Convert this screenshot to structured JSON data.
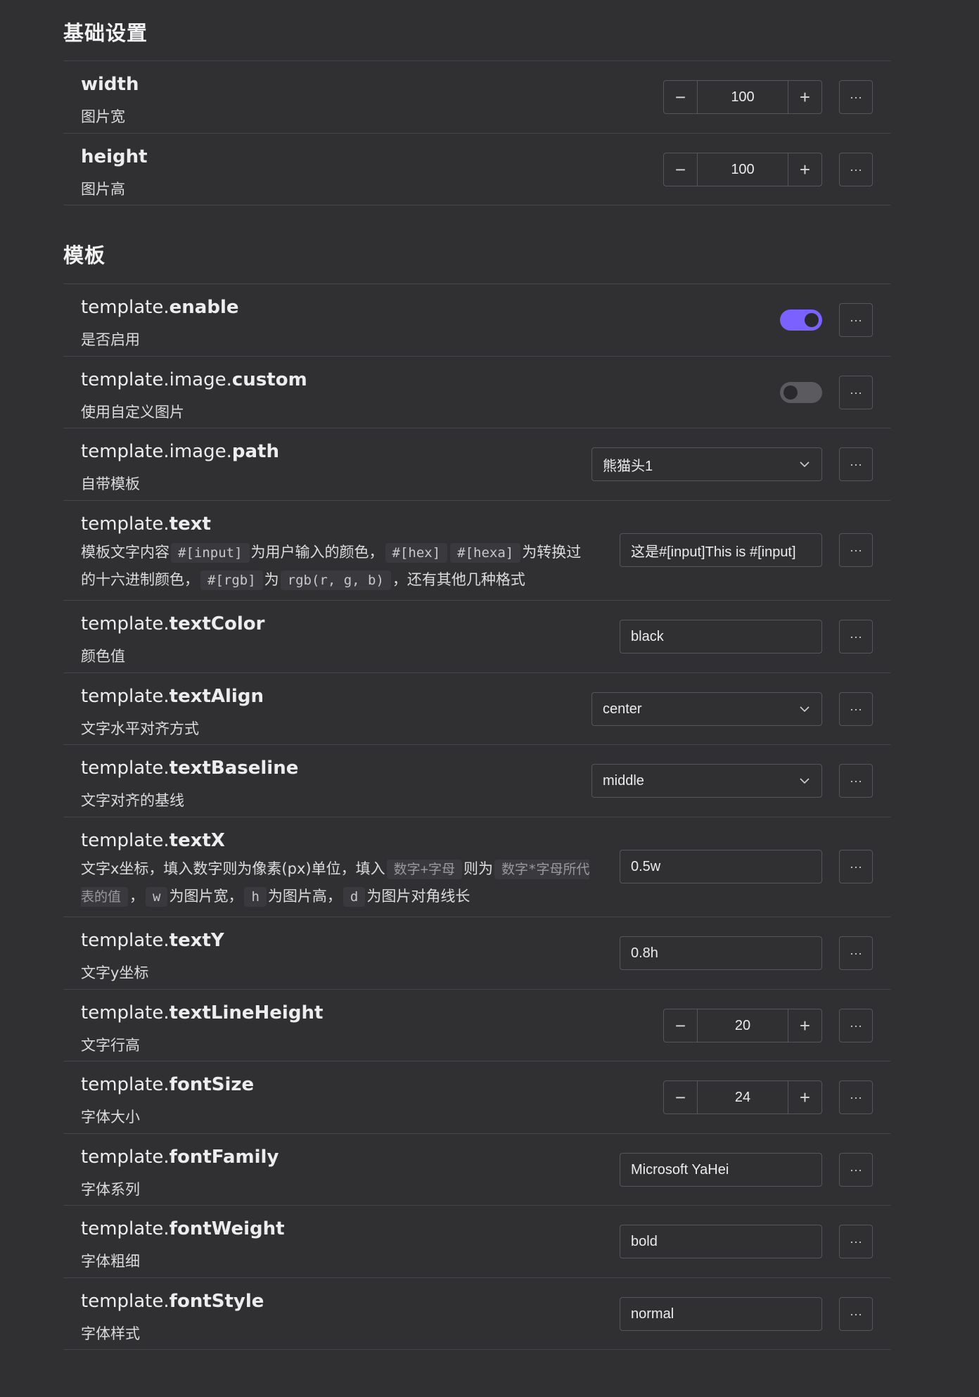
{
  "sections": [
    {
      "title": "基础设置",
      "rows": [
        {
          "prefix": "",
          "key": "width",
          "desc": "图片宽",
          "control": "stepper",
          "value": "100"
        },
        {
          "prefix": "",
          "key": "height",
          "desc": "图片高",
          "control": "stepper",
          "value": "100"
        }
      ]
    },
    {
      "title": "模板",
      "rows": [
        {
          "prefix": "template.",
          "key": "enable",
          "desc": "是否启用",
          "control": "toggle",
          "checked": true
        },
        {
          "prefix": "template.image.",
          "key": "custom",
          "desc": "使用自定义图片",
          "control": "toggle",
          "checked": false
        },
        {
          "prefix": "template.image.",
          "key": "path",
          "desc": "自带模板",
          "control": "select",
          "value": "熊猫头1"
        },
        {
          "prefix": "template.",
          "key": "text",
          "control": "text",
          "value": "这是#[input]This is #[input]",
          "desc_parts": [
            {
              "t": "模板文字内容"
            },
            {
              "c": "#[input]"
            },
            {
              "t": "为用户输入的颜色，"
            },
            {
              "c": "#[hex]"
            },
            {
              "c": "#[hexa]"
            },
            {
              "t": "为转换过的十六进制颜色，"
            },
            {
              "c": "#[rgb]"
            },
            {
              "t": "为"
            },
            {
              "c": "rgb(r, g, b)"
            },
            {
              "t": "，还有其他几种格式"
            }
          ]
        },
        {
          "prefix": "template.",
          "key": "textColor",
          "desc": "颜色值",
          "control": "text",
          "value": "black"
        },
        {
          "prefix": "template.",
          "key": "textAlign",
          "desc": "文字水平对齐方式",
          "control": "select",
          "value": "center"
        },
        {
          "prefix": "template.",
          "key": "textBaseline",
          "desc": "文字对齐的基线",
          "control": "select",
          "value": "middle"
        },
        {
          "prefix": "template.",
          "key": "textX",
          "control": "text",
          "value": "0.5w",
          "desc_parts": [
            {
              "t": "文字x坐标，填入数字则为像素(px)单位，填入"
            },
            {
              "c": "数字+字母",
              "ph": true
            },
            {
              "t": "则为"
            },
            {
              "c": "数字*字母所代表的值",
              "ph": true
            },
            {
              "t": "，"
            },
            {
              "c": "w"
            },
            {
              "t": "为图片宽，"
            },
            {
              "c": "h"
            },
            {
              "t": "为图片高，"
            },
            {
              "c": "d"
            },
            {
              "t": "为图片对角线长"
            }
          ]
        },
        {
          "prefix": "template.",
          "key": "textY",
          "desc": "文字y坐标",
          "control": "text",
          "value": "0.8h"
        },
        {
          "prefix": "template.",
          "key": "textLineHeight",
          "desc": "文字行高",
          "control": "stepper",
          "value": "20"
        },
        {
          "prefix": "template.",
          "key": "fontSize",
          "desc": "字体大小",
          "control": "stepper",
          "value": "24"
        },
        {
          "prefix": "template.",
          "key": "fontFamily",
          "desc": "字体系列",
          "control": "text",
          "value": "Microsoft YaHei"
        },
        {
          "prefix": "template.",
          "key": "fontWeight",
          "desc": "字体粗细",
          "control": "text",
          "value": "bold"
        },
        {
          "prefix": "template.",
          "key": "fontStyle",
          "desc": "字体样式",
          "control": "text",
          "value": "normal"
        }
      ]
    }
  ],
  "icons": {
    "more": "more-horizontal-icon",
    "minus": "minus-icon",
    "plus": "plus-icon",
    "chevron": "chevron-down-icon"
  },
  "glyphs": {
    "more": "···",
    "minus": "−",
    "plus": "+"
  },
  "colors": {
    "accent": "#7b61ff",
    "background": "#303033",
    "border": "#55555b",
    "divider": "#45454a"
  }
}
